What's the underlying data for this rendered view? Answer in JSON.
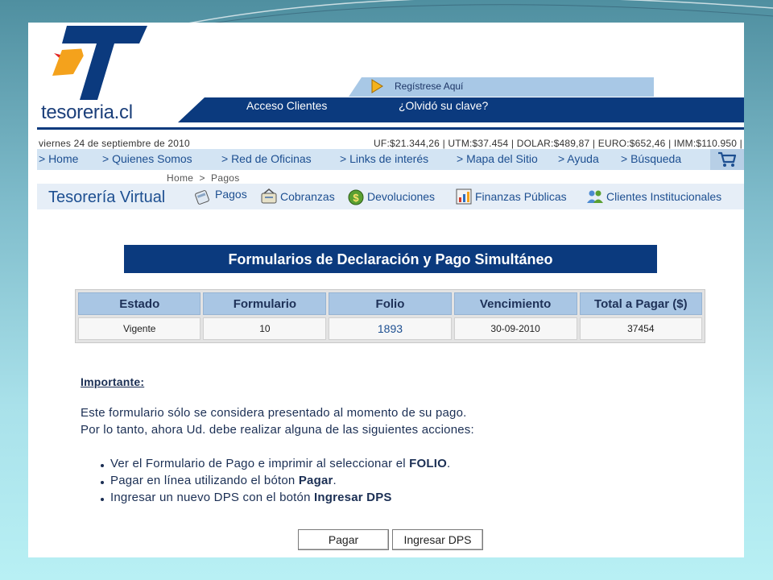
{
  "header": {
    "logo_text": "tesoreria.cl",
    "register_link": "Regístrese Aquí",
    "client_access": "Acceso Clientes",
    "forgot_password": "¿Olvidó su clave?"
  },
  "datebar": {
    "date": "viernes 24 de septiembre de 2010",
    "rates": "UF:$21.344,26 | UTM:$37.454 | DOLAR:$489,87 | EURO:$652,46 | IMM:$110.950 |"
  },
  "menu": {
    "items": [
      {
        "label": "> Home"
      },
      {
        "label": "> Quienes Somos"
      },
      {
        "label": "> Red de Oficinas"
      },
      {
        "label": "> Links de interés"
      },
      {
        "label": "> Mapa del Sitio"
      },
      {
        "label": "> Ayuda"
      },
      {
        "label": "> Búsqueda"
      }
    ]
  },
  "breadcrumb": "Home  >  Pagos",
  "virtual": {
    "title": "Tesorería Virtual",
    "items": [
      {
        "label": "Pagos",
        "icon": "pagos-icon"
      },
      {
        "label": "Cobranzas",
        "icon": "cobranzas-icon"
      },
      {
        "label": "Devoluciones",
        "icon": "devoluciones-icon"
      },
      {
        "label": "Finanzas Públicas",
        "icon": "finanzas-icon"
      },
      {
        "label": "Clientes Institucionales",
        "icon": "clientes-icon"
      }
    ]
  },
  "form": {
    "title": "Formularios de Declaración y Pago Simultáneo",
    "columns": [
      "Estado",
      "Formulario",
      "Folio",
      "Vencimiento",
      "Total a Pagar ($)"
    ],
    "row": {
      "estado": "Vigente",
      "formulario": "10",
      "folio": "1893",
      "vencimiento": "30-09-2010",
      "total": "37454"
    }
  },
  "notice": {
    "heading": "Importante:",
    "line1": "Este formulario sólo se considera presentado al momento de su pago.",
    "line2": "Por lo tanto, ahora Ud. debe realizar alguna de las siguientes acciones:",
    "bullets": [
      {
        "text": "Ver el Formulario de Pago e imprimir al seleccionar el ",
        "bold": "FOLIO",
        "end": "."
      },
      {
        "text": "Pagar en línea utilizando el bóton ",
        "bold": "Pagar",
        "end": "."
      },
      {
        "text": "Ingresar un nuevo DPS con el botón ",
        "bold": "Ingresar DPS",
        "end": ""
      }
    ]
  },
  "buttons": {
    "pay": "Pagar",
    "new_dps": "Ingresar DPS"
  },
  "colors": {
    "brand_blue": "#0b3a7e",
    "accent_red": "#e32626",
    "accent_orange": "#f4a21c",
    "table_header": "#a9c6e4"
  }
}
